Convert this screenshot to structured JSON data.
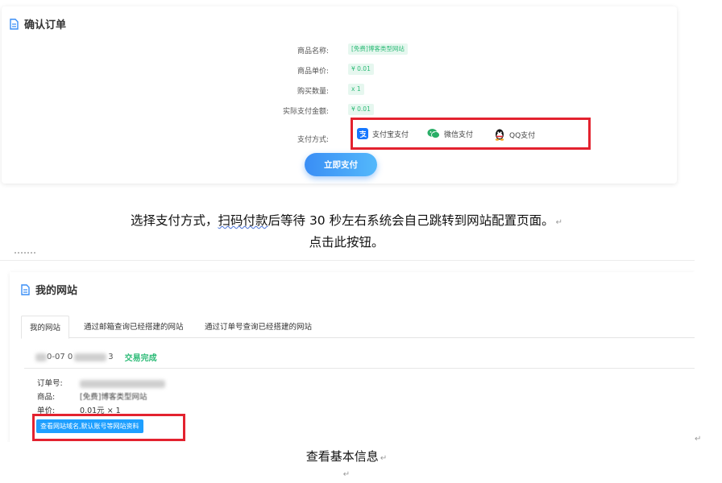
{
  "order_card": {
    "title": "确认订单",
    "fields": [
      {
        "label": "商品名称:",
        "value": "[免费]博客类型网站"
      },
      {
        "label": "商品单价:",
        "value": "¥ 0.01"
      },
      {
        "label": "购买数量:",
        "value": "x 1"
      },
      {
        "label": "实际支付金额:",
        "value": "¥ 0.01"
      }
    ],
    "pay_method_label": "支付方式:",
    "pay_options": [
      {
        "label": "支付宝支付",
        "icon": "alipay-icon",
        "color": "#1677ff"
      },
      {
        "label": "微信支付",
        "icon": "wechat-icon",
        "color": "#2aae67"
      },
      {
        "label": "QQ支付",
        "icon": "qq-icon",
        "color": "#111111"
      }
    ],
    "pay_button": "立即支付"
  },
  "doc": {
    "line1_pre": "选择支付方式，",
    "line1_squiggle": "扫码付款",
    "line1_post": "后等待 30 秒左右系统会自己跳转到网站配置页面。",
    "line2": "点击此按钮。",
    "line3": "查看基本信息",
    "para_mark": "↵"
  },
  "site_card": {
    "title": "我的网站",
    "tabs": [
      "我的网站",
      "通过邮箱查询已经搭建的网站",
      "通过订单号查询已经搭建的网站"
    ],
    "order_date_fragment": "0-07 0",
    "order_time_fragment": "3",
    "status": "交易完成",
    "rows": [
      {
        "label": "订单号:",
        "value": ""
      },
      {
        "label": "商品:",
        "value": "[免费]博客类型网站"
      },
      {
        "label": "单价:",
        "value": "0.01元 × 1"
      }
    ],
    "info_button": "查看网站域名,默认账号等网站资料"
  },
  "colors": {
    "highlight_box": "#e3222f",
    "primary": "#1e9fff",
    "success": "#2dbb77"
  }
}
